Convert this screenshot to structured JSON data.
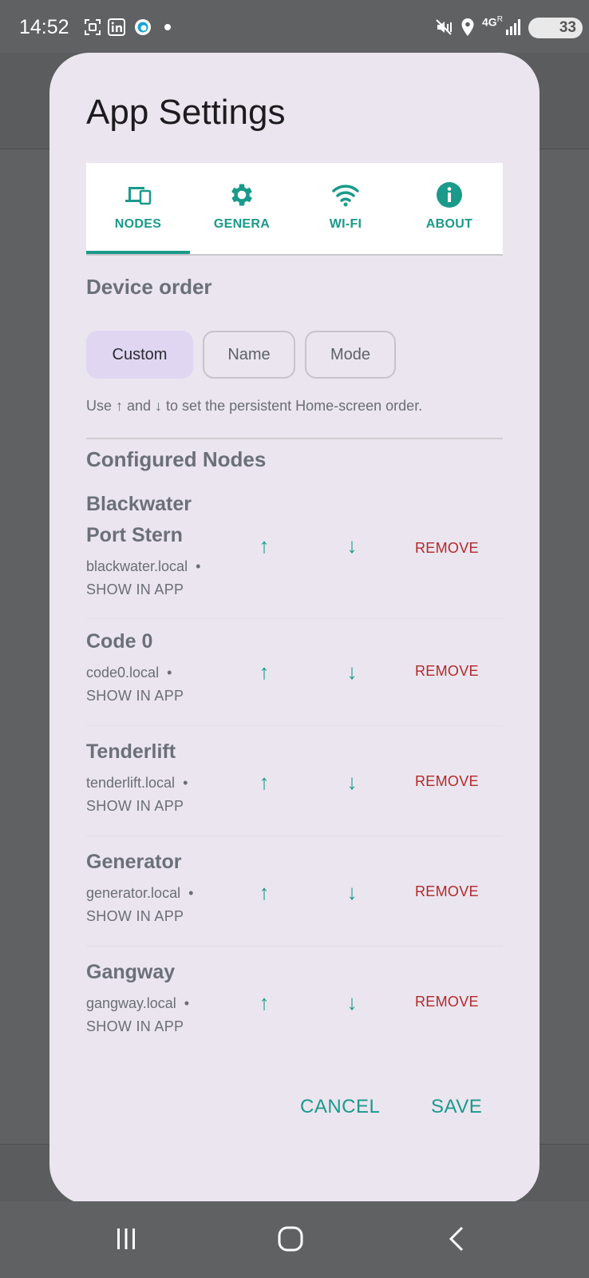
{
  "status_bar": {
    "time": "14:52",
    "network": "4G",
    "network_sub": "R",
    "battery": "33",
    "icons": [
      "screenshot-icon",
      "linkedin-icon",
      "edge-icon",
      "dot-icon",
      "mute-vibrate-icon",
      "location-icon",
      "signal-icon",
      "battery-icon"
    ]
  },
  "dialog": {
    "title": "App Settings",
    "tabs": [
      {
        "label": "NODES",
        "icon": "devices-icon",
        "selected": true
      },
      {
        "label": "GENERA",
        "icon": "gear-icon",
        "selected": false
      },
      {
        "label": "WI-FI",
        "icon": "wifi-icon",
        "selected": false
      },
      {
        "label": "ABOUT",
        "icon": "info-icon",
        "selected": false
      }
    ],
    "device_order": {
      "title": "Device order",
      "options": [
        "Custom",
        "Name",
        "Mode"
      ],
      "selected": "Custom",
      "hint": "Use ↑ and ↓ to set the persistent Home-screen order."
    },
    "configured_nodes": {
      "title": "Configured Nodes",
      "up_glyph": "↑",
      "down_glyph": "↓",
      "remove_label": "REMOVE",
      "show_label": "SHOW IN APP",
      "bullet": "•",
      "nodes": [
        {
          "name_line1": "Blackwater",
          "name_line2": "Port Stern",
          "host": "blackwater.local"
        },
        {
          "name_line1": "Code 0",
          "host": "code0.local"
        },
        {
          "name_line1": "Tenderlift",
          "host": "tenderlift.local"
        },
        {
          "name_line1": "Generator",
          "host": "generator.local"
        },
        {
          "name_line1": "Gangway",
          "host": "gangway.local"
        }
      ]
    },
    "actions": {
      "cancel": "CANCEL",
      "save": "SAVE"
    }
  },
  "colors": {
    "accent": "#1a9a8a",
    "danger": "#b02a2a",
    "dialog_bg": "#ebe5ef",
    "selected_chip": "#e0d6f2",
    "scrim": "#5f6163"
  },
  "nav_bar": {
    "buttons": [
      "recents-icon",
      "home-icon",
      "back-icon"
    ]
  }
}
